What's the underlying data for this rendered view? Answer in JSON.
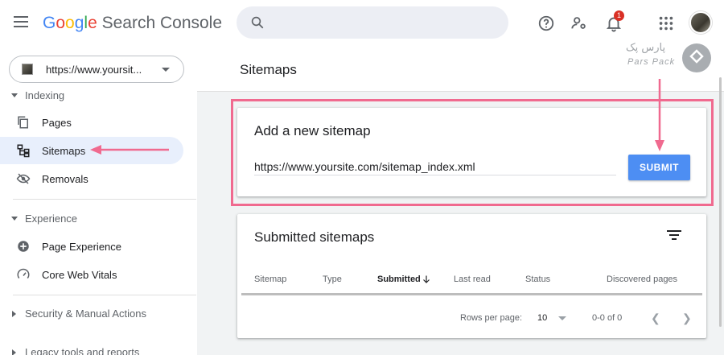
{
  "header": {
    "logo_google": [
      "G",
      "o",
      "o",
      "g",
      "l",
      "e"
    ],
    "logo_product": "Search Console",
    "notification_count": "1"
  },
  "sidebar": {
    "property_url": "https://www.yoursit...",
    "sections": {
      "indexing": "Indexing",
      "experience": "Experience",
      "security": "Security & Manual Actions",
      "legacy": "Legacy tools and reports"
    },
    "items": [
      {
        "label": "Pages",
        "icon": "pages-icon"
      },
      {
        "label": "Sitemaps",
        "icon": "sitemap-icon",
        "active": true
      },
      {
        "label": "Removals",
        "icon": "removals-icon"
      },
      {
        "label": "Page Experience",
        "icon": "page-experience-icon"
      },
      {
        "label": "Core Web Vitals",
        "icon": "gauge-icon"
      }
    ]
  },
  "main": {
    "page_title": "Sitemaps",
    "add_card": {
      "title": "Add a new sitemap",
      "input_value": "https://www.yoursite.com/sitemap_index.xml",
      "submit_label": "SUBMIT"
    },
    "submitted_card": {
      "title": "Submitted sitemaps",
      "columns": [
        "Sitemap",
        "Type",
        "Submitted",
        "Last read",
        "Status",
        "Discovered pages"
      ],
      "rows_per_page_label": "Rows per page:",
      "rows_per_page_value": "10",
      "range": "0-0 of 0"
    }
  },
  "watermark": {
    "text_fa": "پارس پک",
    "text_en": "Pars Pack"
  },
  "colors": {
    "accent": "#4d8ef3",
    "active_nav": "#e8effc",
    "annotation": "#f06a8f"
  }
}
